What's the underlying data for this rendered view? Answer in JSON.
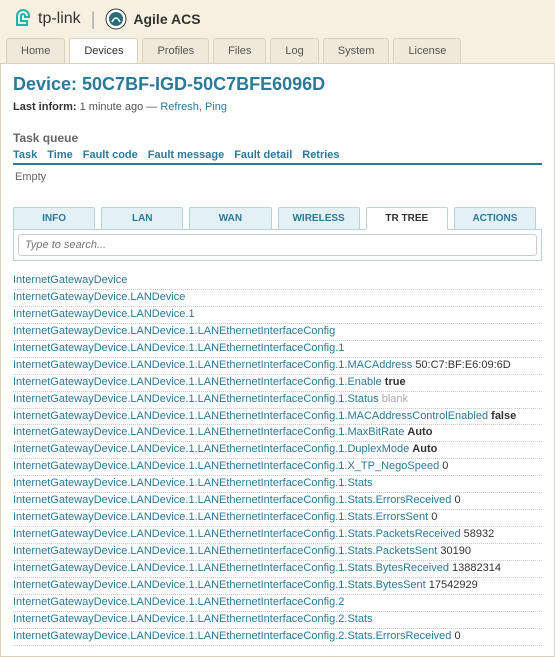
{
  "brand": {
    "tp_label": "tp-link",
    "acs_label": "Agile ACS"
  },
  "nav": {
    "items": [
      {
        "label": "Home"
      },
      {
        "label": "Devices"
      },
      {
        "label": "Profiles"
      },
      {
        "label": "Files"
      },
      {
        "label": "Log"
      },
      {
        "label": "System"
      },
      {
        "label": "License"
      }
    ],
    "active_index": 1
  },
  "device": {
    "title": "Device: 50C7BF-IGD-50C7BFE6096D",
    "last_inform_label": "Last inform:",
    "last_inform_value": "1 minute ago",
    "sep": " — ",
    "refresh": "Refresh",
    "ping": "Ping"
  },
  "task_queue": {
    "title": "Task queue",
    "cols": [
      "Task",
      "Time",
      "Fault code",
      "Fault message",
      "Fault detail",
      "Retries"
    ],
    "empty": "Empty"
  },
  "sub_tabs": {
    "items": [
      "INFO",
      "LAN",
      "WAN",
      "WIRELESS",
      "TR TREE",
      "ACTIONS"
    ],
    "active_index": 4
  },
  "search": {
    "placeholder": "Type to search..."
  },
  "tree": [
    {
      "path": "InternetGatewayDevice"
    },
    {
      "path": "InternetGatewayDevice.LANDevice"
    },
    {
      "path": "InternetGatewayDevice.LANDevice.1"
    },
    {
      "path": "InternetGatewayDevice.LANDevice.1.LANEthernetInterfaceConfig"
    },
    {
      "path": "InternetGatewayDevice.LANDevice.1.LANEthernetInterfaceConfig.1"
    },
    {
      "path": "InternetGatewayDevice.LANDevice.1.LANEthernetInterfaceConfig.1.MACAddress",
      "value": "50:C7:BF:E6:09:6D"
    },
    {
      "path": "InternetGatewayDevice.LANDevice.1.LANEthernetInterfaceConfig.1.Enable",
      "value": "true",
      "bold": true
    },
    {
      "path": "InternetGatewayDevice.LANDevice.1.LANEthernetInterfaceConfig.1.Status",
      "value": "blank",
      "faint": true
    },
    {
      "path": "InternetGatewayDevice.LANDevice.1.LANEthernetInterfaceConfig.1.MACAddressControlEnabled",
      "value": "false",
      "bold": true
    },
    {
      "path": "InternetGatewayDevice.LANDevice.1.LANEthernetInterfaceConfig.1.MaxBitRate",
      "value": "Auto",
      "bold": true
    },
    {
      "path": "InternetGatewayDevice.LANDevice.1.LANEthernetInterfaceConfig.1.DuplexMode",
      "value": "Auto",
      "bold": true
    },
    {
      "path": "InternetGatewayDevice.LANDevice.1.LANEthernetInterfaceConfig.1.X_TP_NegoSpeed",
      "value": "0"
    },
    {
      "path": "InternetGatewayDevice.LANDevice.1.LANEthernetInterfaceConfig.1.Stats"
    },
    {
      "path": "InternetGatewayDevice.LANDevice.1.LANEthernetInterfaceConfig.1.Stats.ErrorsReceived",
      "value": "0"
    },
    {
      "path": "InternetGatewayDevice.LANDevice.1.LANEthernetInterfaceConfig.1.Stats.ErrorsSent",
      "value": "0"
    },
    {
      "path": "InternetGatewayDevice.LANDevice.1.LANEthernetInterfaceConfig.1.Stats.PacketsReceived",
      "value": "58932"
    },
    {
      "path": "InternetGatewayDevice.LANDevice.1.LANEthernetInterfaceConfig.1.Stats.PacketsSent",
      "value": "30190"
    },
    {
      "path": "InternetGatewayDevice.LANDevice.1.LANEthernetInterfaceConfig.1.Stats.BytesReceived",
      "value": "13882314"
    },
    {
      "path": "InternetGatewayDevice.LANDevice.1.LANEthernetInterfaceConfig.1.Stats.BytesSent",
      "value": "17542929"
    },
    {
      "path": "InternetGatewayDevice.LANDevice.1.LANEthernetInterfaceConfig.2"
    },
    {
      "path": "InternetGatewayDevice.LANDevice.1.LANEthernetInterfaceConfig.2.Stats"
    },
    {
      "path": "InternetGatewayDevice.LANDevice.1.LANEthernetInterfaceConfig.2.Stats.ErrorsReceived",
      "value": "0"
    }
  ]
}
